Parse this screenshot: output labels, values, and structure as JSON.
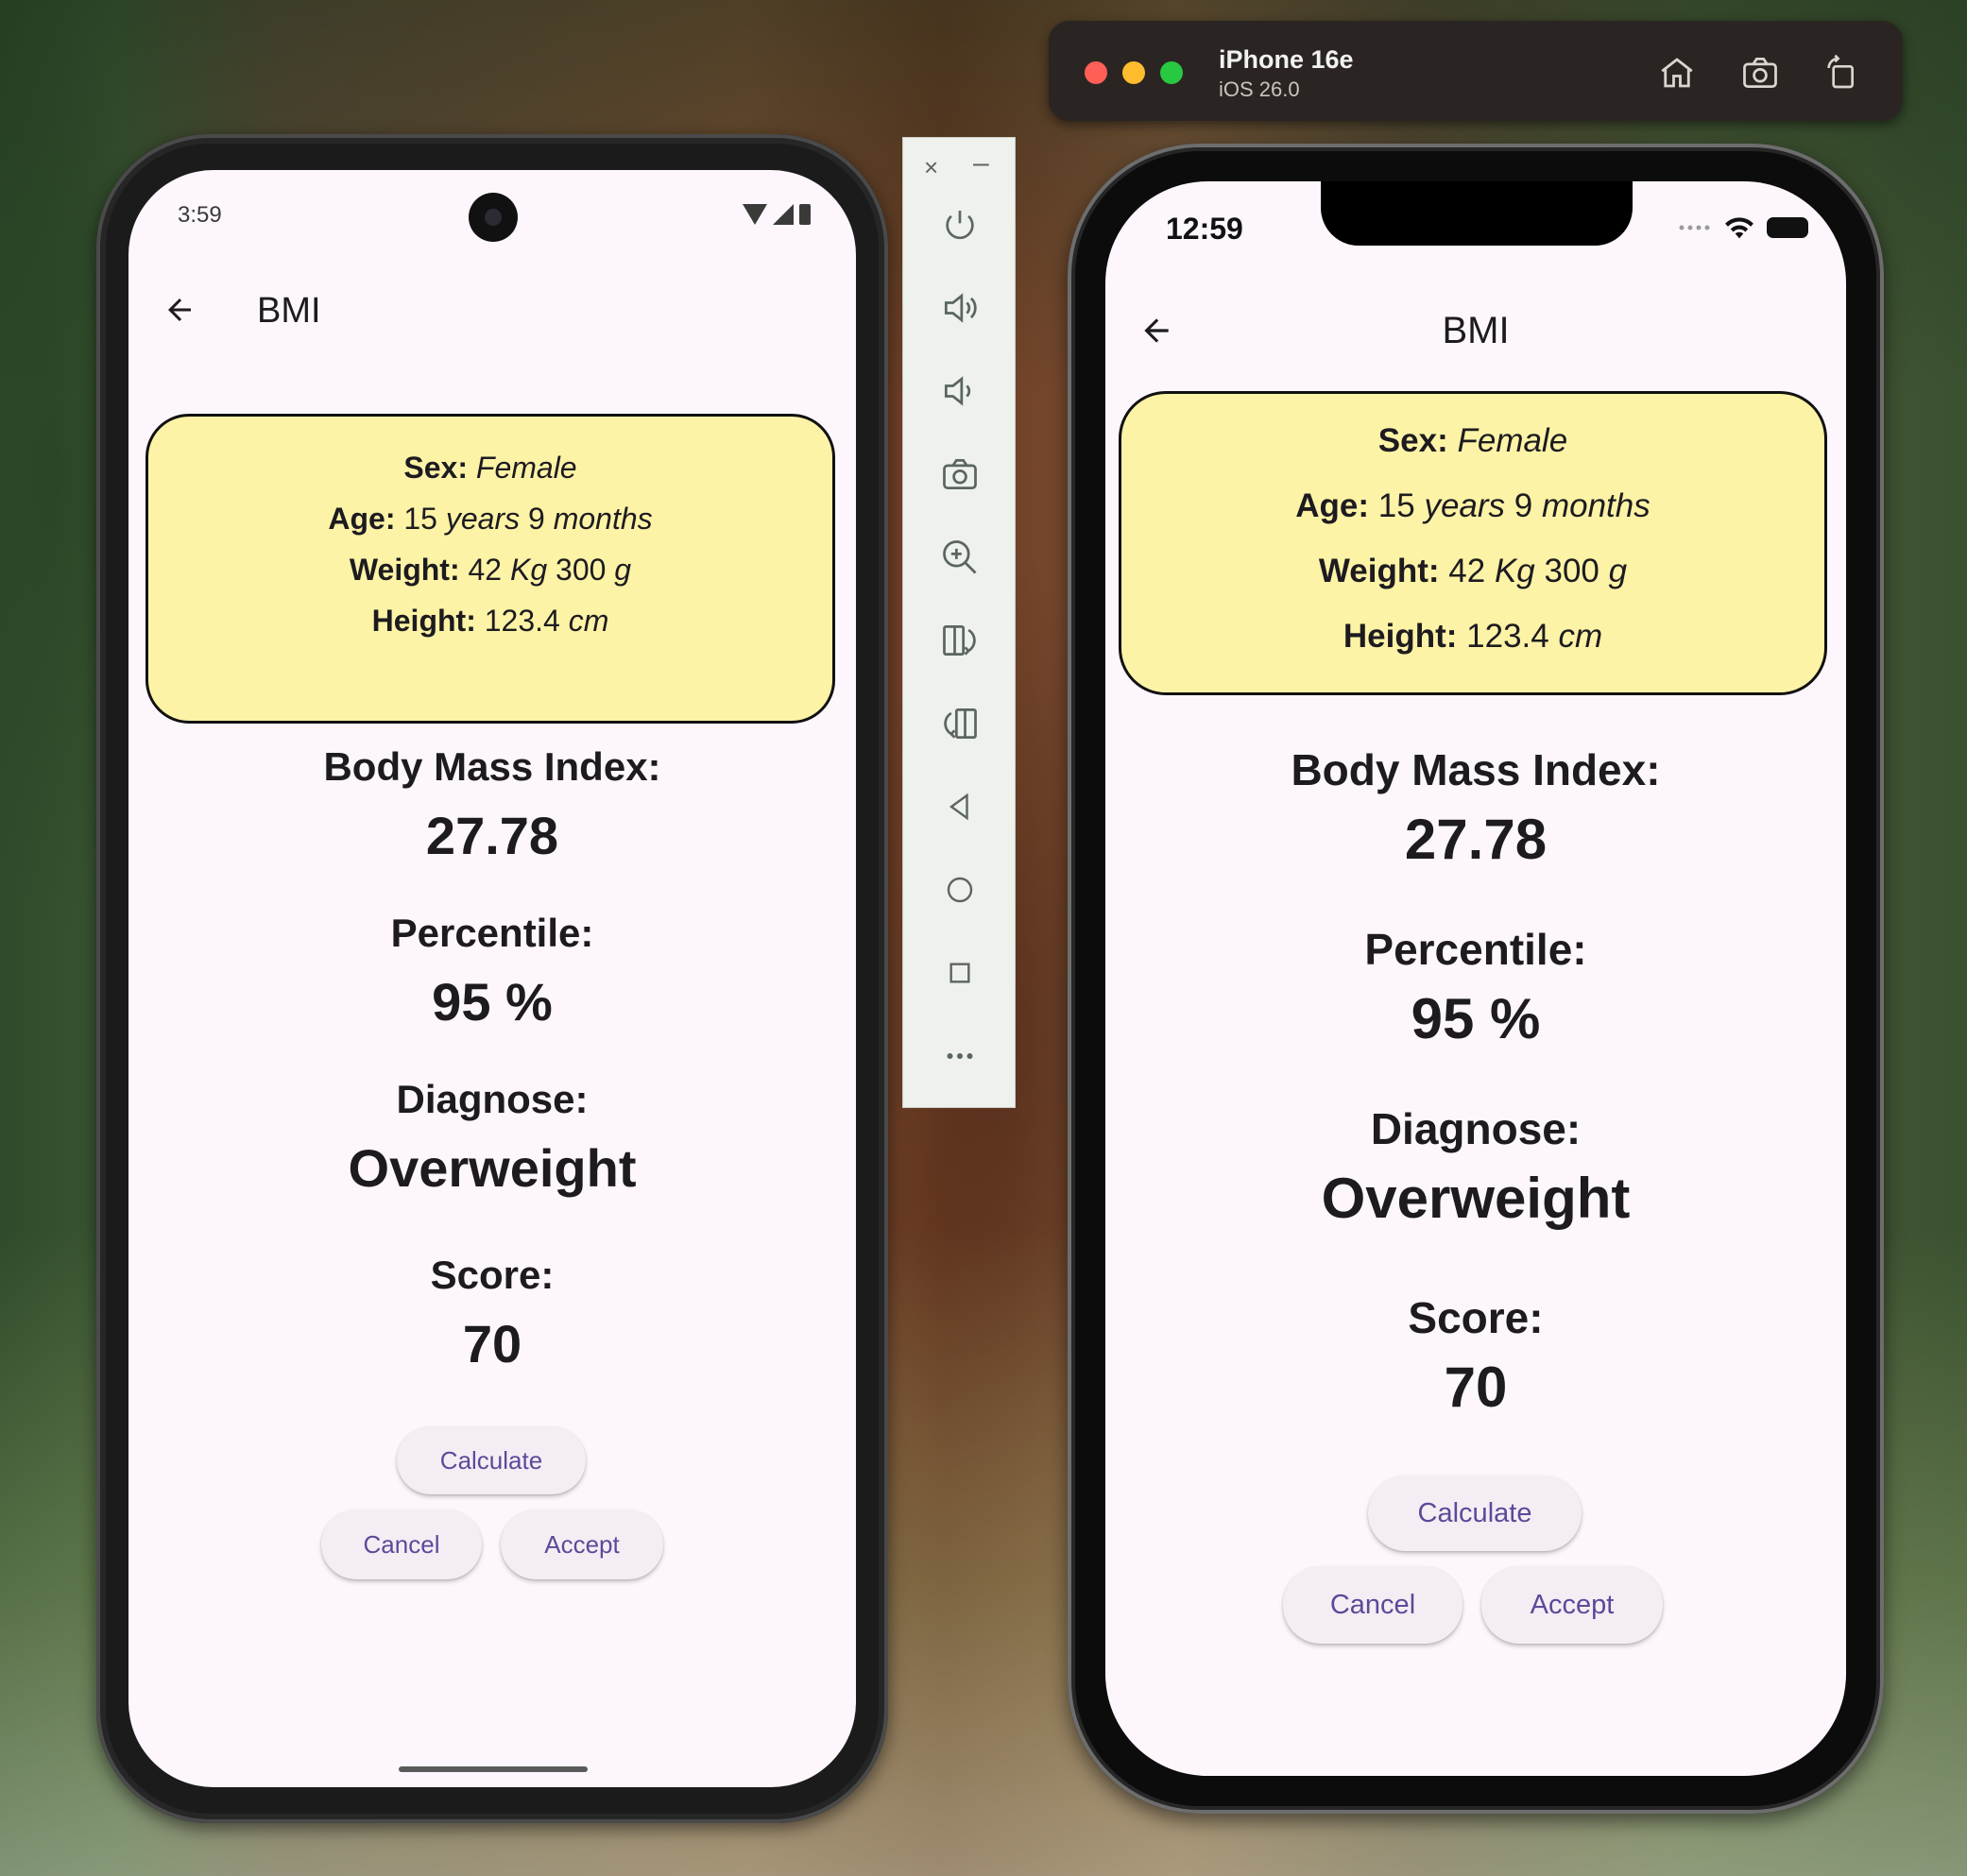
{
  "android": {
    "status_time": "3:59",
    "appbar_title": "BMI",
    "card": {
      "sex_label": "Sex:",
      "sex_value": "Female",
      "age_label": "Age:",
      "age_years": "15",
      "age_years_unit": "years",
      "age_months": "9",
      "age_months_unit": "months",
      "weight_label": "Weight:",
      "weight_kg": "42",
      "weight_kg_unit": "Kg",
      "weight_g": "300",
      "weight_g_unit": "g",
      "height_label": "Height:",
      "height_value": "123.4",
      "height_unit": "cm"
    },
    "bmi_label": "Body Mass Index:",
    "bmi_value": "27.78",
    "percentile_label": "Percentile:",
    "percentile_value": "95 %",
    "diagnose_label": "Diagnose:",
    "diagnose_value": "Overweight",
    "score_label": "Score:",
    "score_value": "70",
    "buttons": {
      "calculate": "Calculate",
      "cancel": "Cancel",
      "accept": "Accept"
    }
  },
  "emulator_toolbar": {
    "close_glyph": "×",
    "minimize_glyph": "–",
    "icons": [
      "power-icon",
      "volume-up-icon",
      "volume-down-icon",
      "camera-icon",
      "zoom-in-icon",
      "rotate-left-icon",
      "rotate-right-icon",
      "back-icon",
      "home-icon",
      "overview-icon",
      "more-icon"
    ]
  },
  "simulator": {
    "device_name": "iPhone 16e",
    "os_version": "iOS 26.0",
    "traffic_lights": [
      "#ff5f57",
      "#febc2e",
      "#28c840"
    ],
    "icons": [
      "home-icon",
      "screenshot-icon",
      "rotate-icon"
    ]
  },
  "ios": {
    "status_time": "12:59",
    "appbar_title": "BMI",
    "card": {
      "sex_label": "Sex:",
      "sex_value": "Female",
      "age_label": "Age:",
      "age_years": "15",
      "age_years_unit": "years",
      "age_months": "9",
      "age_months_unit": "months",
      "weight_label": "Weight:",
      "weight_kg": "42",
      "weight_kg_unit": "Kg",
      "weight_g": "300",
      "weight_g_unit": "g",
      "height_label": "Height:",
      "height_value": "123.4",
      "height_unit": "cm"
    },
    "bmi_label": "Body Mass Index:",
    "bmi_value": "27.78",
    "percentile_label": "Percentile:",
    "percentile_value": "95 %",
    "diagnose_label": "Diagnose:",
    "diagnose_value": "Overweight",
    "score_label": "Score:",
    "score_value": "70",
    "buttons": {
      "calculate": "Calculate",
      "cancel": "Cancel",
      "accept": "Accept"
    }
  },
  "colors": {
    "card_background": "#fdf3a6",
    "button_text": "#5b4a99",
    "screen_background": "#fdf7fd"
  }
}
